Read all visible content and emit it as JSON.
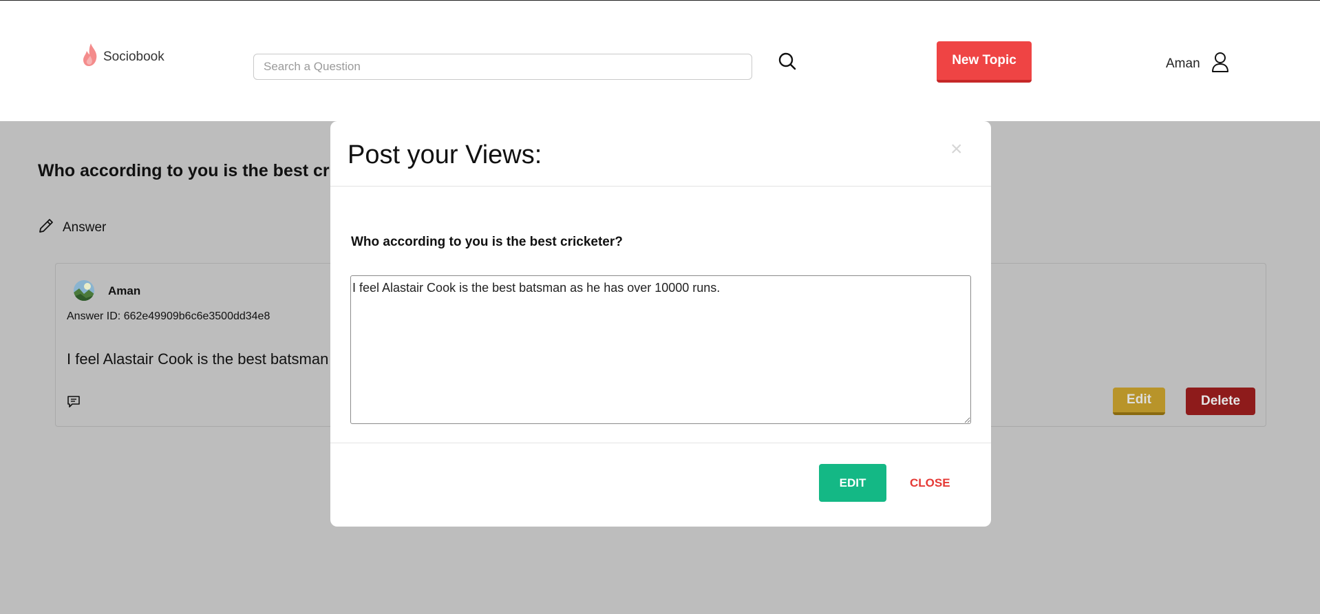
{
  "header": {
    "logo_text": "Sociobook",
    "search_placeholder": "Search a Question",
    "new_topic_label": "New Topic",
    "user_name": "Aman"
  },
  "question": {
    "title": "Who according to you is the best cric",
    "answer_label": "Answer"
  },
  "answer_card": {
    "author": "Aman",
    "answer_id": "Answer ID: 662e49909b6c6e3500dd34e8",
    "text": "I feel Alastair Cook is the best batsman",
    "edit_label": "Edit",
    "delete_label": "Delete"
  },
  "modal": {
    "title": "Post your Views:",
    "close_symbol": "×",
    "question": "Who according to you is the best cricketer?",
    "textarea_value": "I feel Alastair Cook is the best batsman as he has over 10000 runs.",
    "edit_label": "EDIT",
    "close_label": "CLOSE"
  },
  "colors": {
    "brand_red": "#ef4444",
    "success_green": "#14b885",
    "backdrop": "#bdbdbd",
    "warning_yellow": "#b8942a",
    "danger_dark_red": "#8e1b1b"
  },
  "icons": [
    "flame-logo-icon",
    "search-icon",
    "user-icon",
    "pencil-icon",
    "comment-icon",
    "close-icon"
  ]
}
